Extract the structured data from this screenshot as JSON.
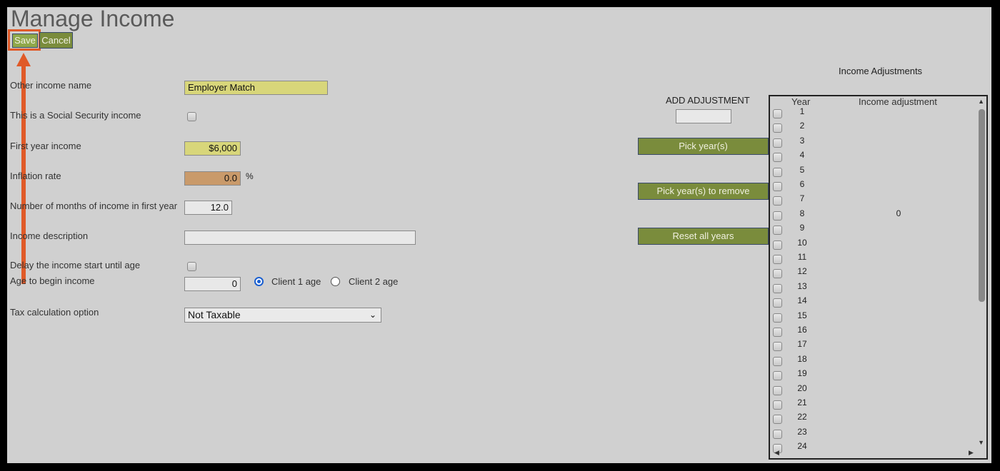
{
  "page": {
    "title": "Manage Income"
  },
  "toolbar": {
    "save_label": "Save",
    "cancel_label": "Cancel"
  },
  "form": {
    "other_income_name": {
      "label": "Other income name",
      "value": "Employer Match"
    },
    "social_security": {
      "label": "This is a Social Security income",
      "checked": false
    },
    "first_year_income": {
      "label": "First year income",
      "value": "$6,000"
    },
    "inflation_rate": {
      "label": "Inflation rate",
      "value": "0.0",
      "unit": "%"
    },
    "months_first_year": {
      "label": "Number of months of income in first year",
      "value": "12.0"
    },
    "income_description": {
      "label": "Income description",
      "value": ""
    },
    "delay_start": {
      "label": "Delay the income start until age",
      "checked": false
    },
    "age_to_begin": {
      "label": "Age to begin income",
      "value": "0",
      "client1_label": "Client 1 age",
      "client2_label": "Client 2 age",
      "selected": "Client 1 age"
    },
    "tax_option": {
      "label": "Tax calculation option",
      "value": "Not Taxable"
    }
  },
  "adjustments": {
    "title": "Income Adjustments",
    "add_label": "ADD ADJUSTMENT",
    "add_value": "",
    "pick_years_label": "Pick year(s)",
    "pick_remove_label": "Pick year(s) to remove",
    "reset_label": "Reset all years",
    "col_year": "Year",
    "col_adjustment": "Income adjustment",
    "rows": [
      {
        "year": "1",
        "adj": ""
      },
      {
        "year": "2",
        "adj": ""
      },
      {
        "year": "3",
        "adj": ""
      },
      {
        "year": "4",
        "adj": ""
      },
      {
        "year": "5",
        "adj": ""
      },
      {
        "year": "6",
        "adj": ""
      },
      {
        "year": "7",
        "adj": ""
      },
      {
        "year": "8",
        "adj": "0"
      },
      {
        "year": "9",
        "adj": ""
      },
      {
        "year": "10",
        "adj": ""
      },
      {
        "year": "11",
        "adj": ""
      },
      {
        "year": "12",
        "adj": ""
      },
      {
        "year": "13",
        "adj": ""
      },
      {
        "year": "14",
        "adj": ""
      },
      {
        "year": "15",
        "adj": ""
      },
      {
        "year": "16",
        "adj": ""
      },
      {
        "year": "17",
        "adj": ""
      },
      {
        "year": "18",
        "adj": ""
      },
      {
        "year": "19",
        "adj": ""
      },
      {
        "year": "20",
        "adj": ""
      },
      {
        "year": "21",
        "adj": ""
      },
      {
        "year": "22",
        "adj": ""
      },
      {
        "year": "23",
        "adj": ""
      },
      {
        "year": "24",
        "adj": ""
      }
    ]
  },
  "colors": {
    "accent_green": "#7a8c3c",
    "highlight": "#e05a28",
    "field_yellow": "#d8d67a",
    "field_orange": "#c99a6a"
  }
}
